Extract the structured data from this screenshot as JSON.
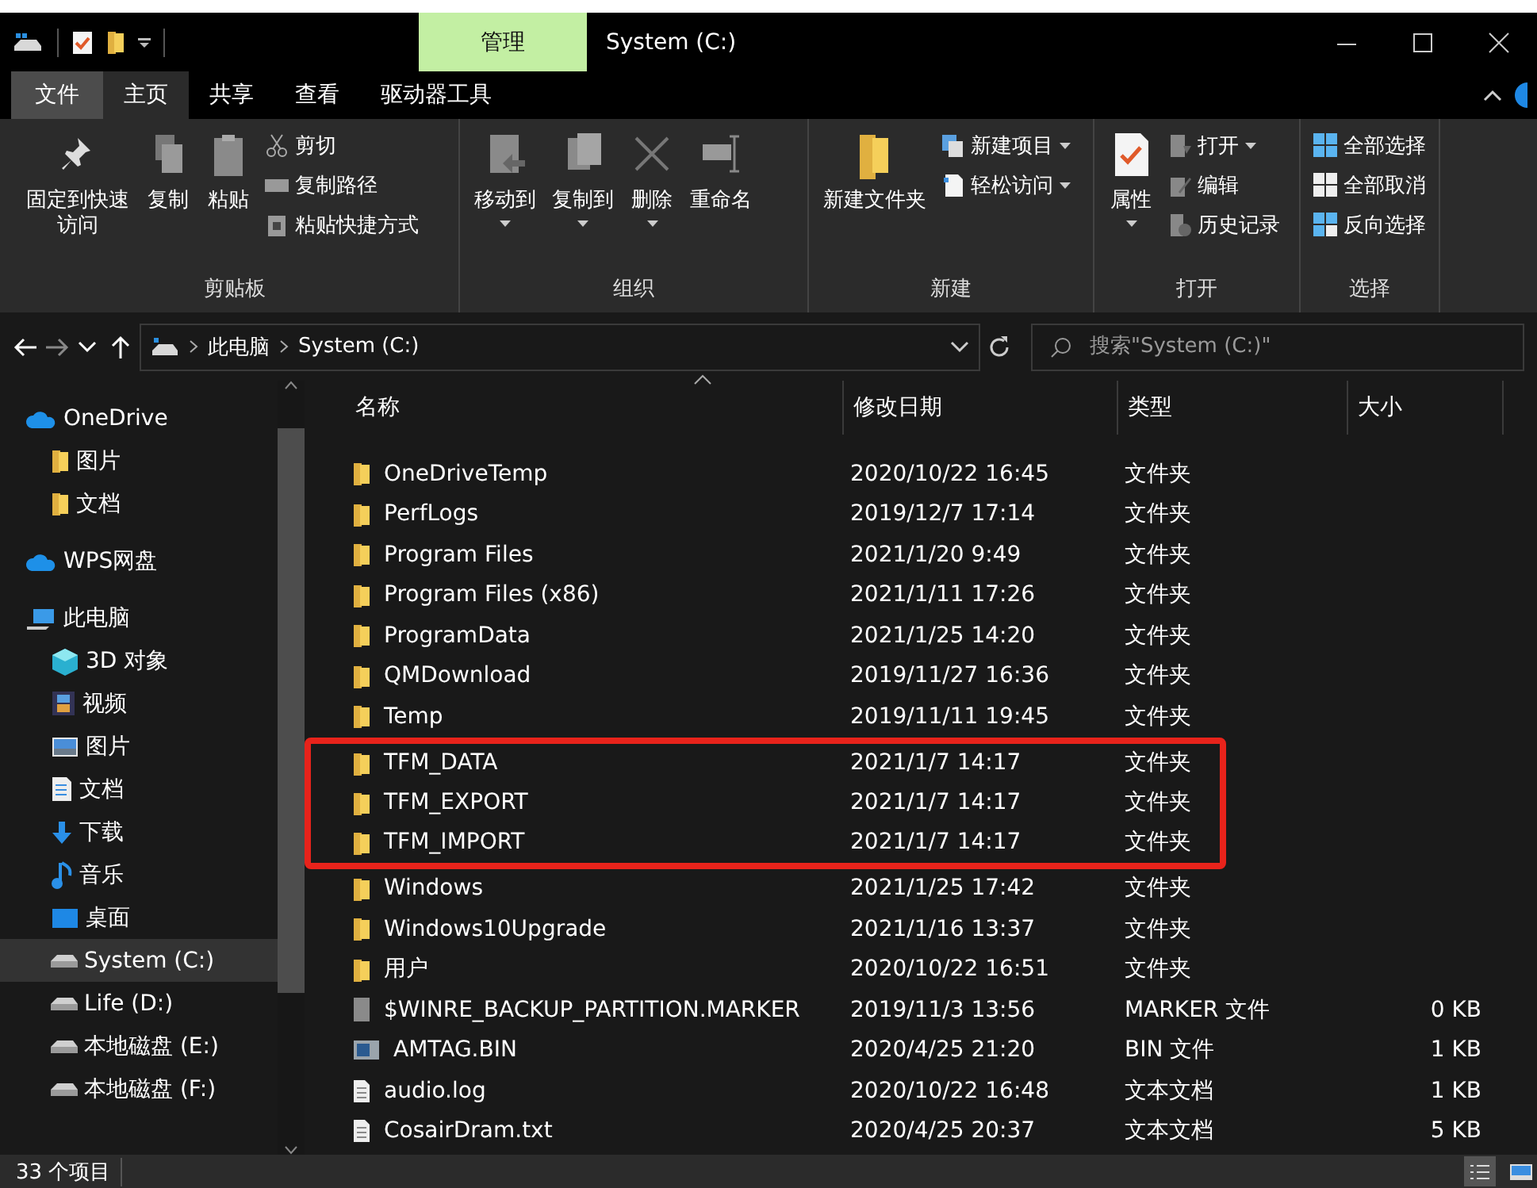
{
  "title_bar": {
    "context_tab": "管理",
    "title": "System (C:)"
  },
  "menu_tabs": [
    {
      "label": "文件",
      "kind": "file",
      "selected": false
    },
    {
      "label": "主页",
      "kind": "tab",
      "selected": true
    },
    {
      "label": "共享",
      "kind": "tab",
      "selected": false
    },
    {
      "label": "查看",
      "kind": "tab",
      "selected": false
    },
    {
      "label": "驱动器工具",
      "kind": "tab",
      "selected": false
    }
  ],
  "ribbon": {
    "groups": [
      {
        "label": "剪贴板",
        "items": [
          {
            "kind": "large",
            "label": "固定到快速访问"
          },
          {
            "kind": "large",
            "label": "复制"
          },
          {
            "kind": "large",
            "label": "粘贴"
          },
          {
            "kind": "small",
            "label": "剪切"
          },
          {
            "kind": "small",
            "label": "复制路径"
          },
          {
            "kind": "small",
            "label": "粘贴快捷方式"
          }
        ]
      },
      {
        "label": "组织",
        "items": [
          {
            "kind": "large",
            "label": "移动到",
            "has_menu": true
          },
          {
            "kind": "large",
            "label": "复制到",
            "has_menu": true
          },
          {
            "kind": "large",
            "label": "删除",
            "has_menu": true
          },
          {
            "kind": "large",
            "label": "重命名"
          }
        ]
      },
      {
        "label": "新建",
        "items": [
          {
            "kind": "large",
            "label": "新建文件夹"
          },
          {
            "kind": "small",
            "label": "新建项目",
            "has_menu": true
          },
          {
            "kind": "small",
            "label": "轻松访问",
            "has_menu": true
          }
        ]
      },
      {
        "label": "打开",
        "items": [
          {
            "kind": "large",
            "label": "属性",
            "has_menu": true
          },
          {
            "kind": "small",
            "label": "打开",
            "has_menu": true
          },
          {
            "kind": "small",
            "label": "编辑"
          },
          {
            "kind": "small",
            "label": "历史记录"
          }
        ]
      },
      {
        "label": "选择",
        "items": [
          {
            "kind": "small",
            "label": "全部选择"
          },
          {
            "kind": "small",
            "label": "全部取消"
          },
          {
            "kind": "small",
            "label": "反向选择"
          }
        ]
      }
    ]
  },
  "address_bar": {
    "path": [
      "此电脑",
      "System (C:)"
    ],
    "search_placeholder": "搜索\"System (C:)\""
  },
  "sidebar": {
    "items": [
      {
        "label": "OneDrive",
        "kind": "cloud",
        "selected": false,
        "children": [
          {
            "label": "图片",
            "kind": "folder",
            "selected": false
          },
          {
            "label": "文档",
            "kind": "folder",
            "selected": false
          }
        ]
      },
      {
        "label": "WPS网盘",
        "kind": "cloud",
        "selected": false
      },
      {
        "label": "此电脑",
        "kind": "pc",
        "selected": false,
        "children": [
          {
            "label": "3D 对象",
            "kind": "cube",
            "selected": false
          },
          {
            "label": "视频",
            "kind": "video",
            "selected": false
          },
          {
            "label": "图片",
            "kind": "picture",
            "selected": false
          },
          {
            "label": "文档",
            "kind": "document",
            "selected": false
          },
          {
            "label": "下载",
            "kind": "download",
            "selected": false
          },
          {
            "label": "音乐",
            "kind": "music",
            "selected": false
          },
          {
            "label": "桌面",
            "kind": "desktop",
            "selected": false
          },
          {
            "label": "System (C:)",
            "kind": "drive",
            "selected": true
          },
          {
            "label": "Life (D:)",
            "kind": "drive",
            "selected": false
          },
          {
            "label": "本地磁盘 (E:)",
            "kind": "drive",
            "selected": false
          },
          {
            "label": "本地磁盘 (F:)",
            "kind": "drive",
            "selected": false
          }
        ]
      }
    ]
  },
  "file_list": {
    "columns": [
      {
        "label": "名称",
        "sorted": true
      },
      {
        "label": "修改日期",
        "sorted": false
      },
      {
        "label": "类型",
        "sorted": false
      },
      {
        "label": "大小",
        "sorted": false
      }
    ],
    "rows": [
      {
        "name": "OneDriveTemp",
        "date": "2020/10/22 16:45",
        "type": "文件夹",
        "kind": "folder",
        "highlighted": false
      },
      {
        "name": "PerfLogs",
        "date": "2019/12/7 17:14",
        "type": "文件夹",
        "kind": "folder",
        "highlighted": false
      },
      {
        "name": "Program Files",
        "date": "2021/1/20 9:49",
        "type": "文件夹",
        "kind": "folder",
        "highlighted": false
      },
      {
        "name": "Program Files (x86)",
        "date": "2021/1/11 17:26",
        "type": "文件夹",
        "kind": "folder",
        "highlighted": false
      },
      {
        "name": "ProgramData",
        "date": "2021/1/25 14:20",
        "type": "文件夹",
        "kind": "folder",
        "highlighted": false
      },
      {
        "name": "QMDownload",
        "date": "2019/11/27 16:36",
        "type": "文件夹",
        "kind": "folder",
        "highlighted": false
      },
      {
        "name": "Temp",
        "date": "2019/11/11 19:45",
        "type": "文件夹",
        "kind": "folder",
        "highlighted": false
      },
      {
        "name": "TFM_DATA",
        "date": "2021/1/7 14:17",
        "type": "文件夹",
        "kind": "folder",
        "highlighted": true
      },
      {
        "name": "TFM_EXPORT",
        "date": "2021/1/7 14:17",
        "type": "文件夹",
        "kind": "folder",
        "highlighted": true
      },
      {
        "name": "TFM_IMPORT",
        "date": "2021/1/7 14:17",
        "type": "文件夹",
        "kind": "folder",
        "highlighted": true
      },
      {
        "name": "Windows",
        "date": "2021/1/25 17:42",
        "type": "文件夹",
        "kind": "folder",
        "highlighted": false
      },
      {
        "name": "Windows10Upgrade",
        "date": "2021/1/16 13:37",
        "type": "文件夹",
        "kind": "folder",
        "highlighted": false
      },
      {
        "name": "用户",
        "date": "2020/10/22 16:51",
        "type": "文件夹",
        "kind": "folder",
        "highlighted": false
      },
      {
        "name": "$WINRE_BACKUP_PARTITION.MARKER",
        "date": "2019/11/3 13:56",
        "type": "MARKER 文件",
        "size": "0 KB",
        "kind": "file",
        "highlighted": false
      },
      {
        "name": "AMTAG.BIN",
        "date": "2020/4/25 21:20",
        "type": "BIN 文件",
        "size": "1 KB",
        "kind": "binary",
        "highlighted": false
      },
      {
        "name": "audio.log",
        "date": "2020/10/22 16:48",
        "type": "文本文档",
        "size": "1 KB",
        "kind": "text",
        "highlighted": false
      },
      {
        "name": "CosairDram.txt",
        "date": "2020/4/25 20:37",
        "type": "文本文档",
        "size": "5 KB",
        "kind": "text",
        "highlighted": false
      }
    ]
  },
  "status_bar": {
    "item_count": "33 个项目",
    "views": [
      {
        "kind": "details",
        "selected": true
      },
      {
        "kind": "tiles",
        "selected": false
      }
    ]
  }
}
